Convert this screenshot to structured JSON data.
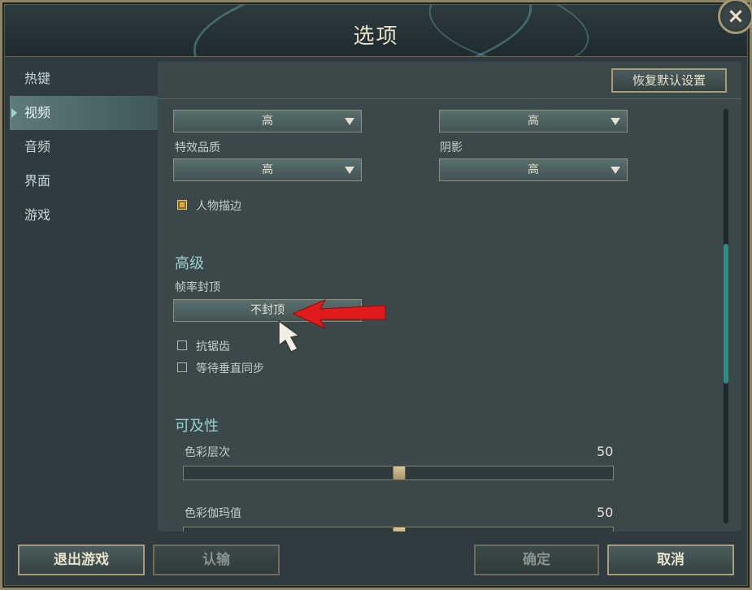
{
  "window": {
    "title": "选项",
    "close_icon": "×"
  },
  "sidebar": {
    "items": [
      {
        "label": "热键",
        "active": false
      },
      {
        "label": "视频",
        "active": true
      },
      {
        "label": "音频",
        "active": false
      },
      {
        "label": "界面",
        "active": false
      },
      {
        "label": "游戏",
        "active": false
      }
    ]
  },
  "toolbar": {
    "reset_label": "恢复默认设置"
  },
  "video": {
    "dropdown_top_left": "高",
    "dropdown_top_right": "高",
    "effects_label": "特效品质",
    "effects_value": "高",
    "shadow_label": "阴影",
    "shadow_value": "高",
    "outline_label": "人物描边",
    "outline_checked": true
  },
  "advanced": {
    "title": "高级",
    "framerate_label": "帧率封顶",
    "framerate_value": "不封顶",
    "antialias_label": "抗锯齿",
    "antialias_checked": false,
    "vsync_label": "等待垂直同步",
    "vsync_checked": false
  },
  "accessibility": {
    "title": "可及性",
    "color_levels_label": "色彩层次",
    "color_levels_value": "50",
    "color_levels_fraction": 0.5,
    "color_gamma_label": "色彩伽玛值",
    "color_gamma_value": "50",
    "color_gamma_fraction": 0.5
  },
  "footer": {
    "exit_label": "退出游戏",
    "surrender_label": "认输",
    "confirm_label": "确定",
    "cancel_label": "取消"
  },
  "colors": {
    "accent_teal": "#2e8a86",
    "gold_border": "#a79d7c",
    "annotation_red": "#e01b1b"
  }
}
